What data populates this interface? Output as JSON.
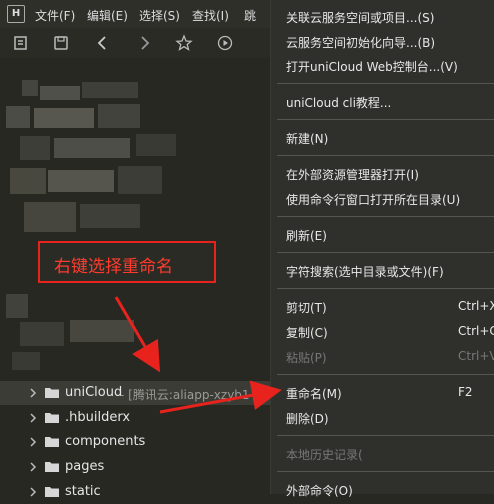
{
  "menubar": {
    "logo": "H",
    "items": [
      "文件(F)",
      "编辑(E)",
      "选择(S)",
      "查找(I)",
      "跳"
    ]
  },
  "toolbar": {
    "icons": [
      "save-all-icon",
      "save-icon",
      "back-icon",
      "forward-icon",
      "star-icon",
      "run-icon"
    ]
  },
  "tree": {
    "items": [
      {
        "label": "uniCloud",
        "meta": "- [腾讯云:aliapp-xzyb1",
        "selected": true
      },
      {
        "label": ".hbuilderx"
      },
      {
        "label": "components"
      },
      {
        "label": "pages"
      },
      {
        "label": "static"
      }
    ]
  },
  "annotation": {
    "text": "右键选择重命名",
    "color": "#e8231e"
  },
  "context_menu": {
    "items": [
      {
        "label": "关联云服务空间或项目...(S)"
      },
      {
        "label": "云服务空间初始化向导...(B)"
      },
      {
        "label": "打开uniCloud Web控制台...(V)"
      },
      {
        "label": "uniCloud cli教程..."
      },
      {
        "label": "新建(N)"
      },
      {
        "label": "在外部资源管理器打开(I)"
      },
      {
        "label": "使用命令行窗口打开所在目录(U)"
      },
      {
        "label": "刷新(E)"
      },
      {
        "label": "字符搜索(选中目录或文件)(F)"
      },
      {
        "label": "剪切(T)",
        "shortcut": "Ctrl+X"
      },
      {
        "label": "复制(C)",
        "shortcut": "Ctrl+C"
      },
      {
        "label": "粘贴(P)",
        "shortcut": "Ctrl+V",
        "disabled": true
      },
      {
        "label": "重命名(M)",
        "shortcut": "F2"
      },
      {
        "label": "删除(D)"
      },
      {
        "label": "本地历史记录(",
        "disabled": true
      },
      {
        "label": "外部命令(O)"
      }
    ]
  }
}
